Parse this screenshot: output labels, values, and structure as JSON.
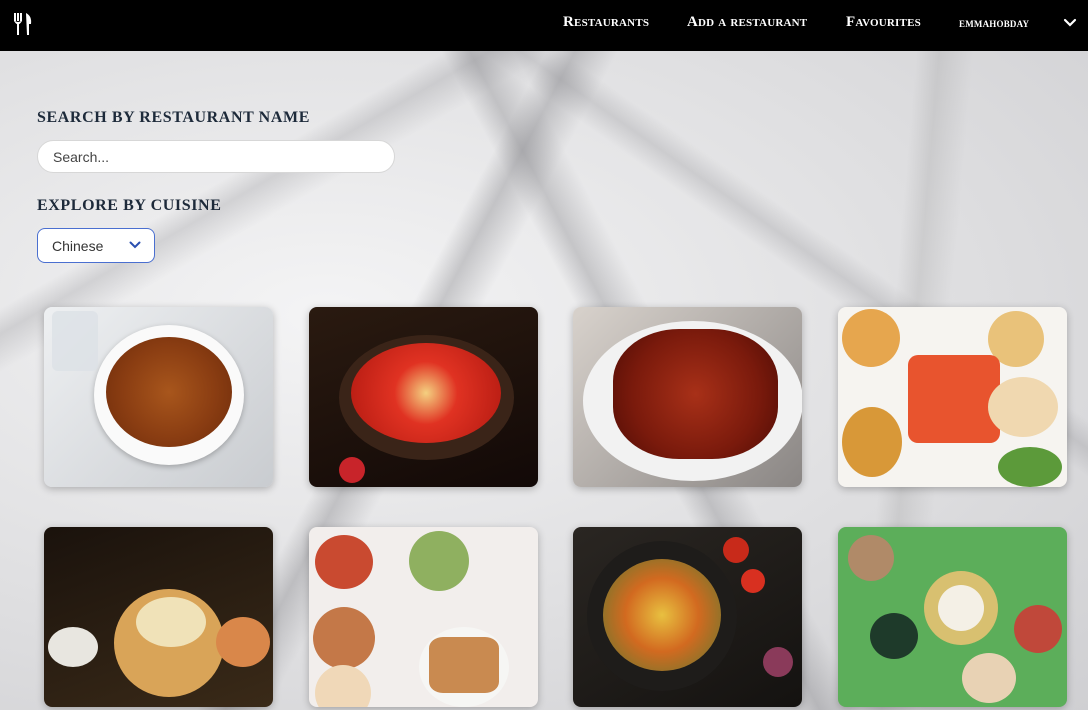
{
  "nav": {
    "logo_icon": "fork-knife-icon",
    "links": [
      "Restaurants",
      "Add a restaurant",
      "Favourites"
    ],
    "user": "emmahobday",
    "user_menu_icon": "chevron-down-icon"
  },
  "search": {
    "heading": "SEARCH BY RESTAURANT NAME",
    "placeholder": "Search..."
  },
  "cuisine": {
    "heading": "EXPLORE BY CUISINE",
    "selected": "Chinese"
  },
  "colors": {
    "navbar": "#000000",
    "select_border": "#4a6fd0",
    "heading_text": "#1d2a3a"
  },
  "restaurants": [
    {
      "photo": "mapo-tofu-photo"
    },
    {
      "photo": "chili-hotpot-photo"
    },
    {
      "photo": "roast-duck-photo"
    },
    {
      "photo": "dim-sum-spread-photo"
    },
    {
      "photo": "steamed-dumplings-photo"
    },
    {
      "photo": "peking-duck-table-photo"
    },
    {
      "photo": "stir-fry-noodles-photo"
    },
    {
      "photo": "banquet-table-photo"
    }
  ]
}
